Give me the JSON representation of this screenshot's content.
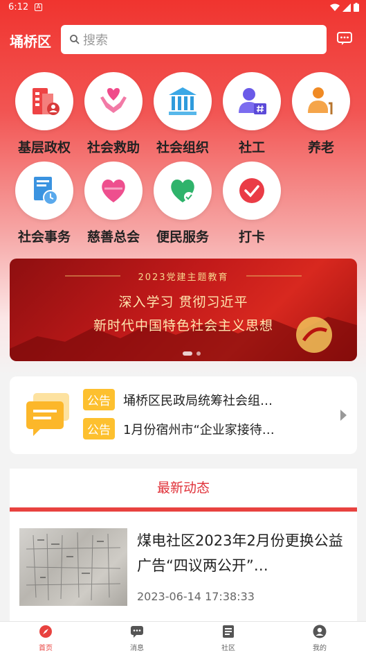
{
  "status": {
    "time": "6:12",
    "a_icon": "A"
  },
  "header": {
    "district": "埇桥区",
    "search_placeholder": "搜索"
  },
  "grid": [
    {
      "label": "基层政权",
      "icon": "building-person-icon"
    },
    {
      "label": "社会救助",
      "icon": "heart-hands-icon"
    },
    {
      "label": "社会组织",
      "icon": "institution-icon"
    },
    {
      "label": "社工",
      "icon": "person-id-icon"
    },
    {
      "label": "养老",
      "icon": "elder-cane-icon"
    },
    {
      "label": "社会事务",
      "icon": "document-clock-icon"
    },
    {
      "label": "慈善总会",
      "icon": "heart-ribbon-icon"
    },
    {
      "label": "便民服务",
      "icon": "heart-check-icon"
    },
    {
      "label": "打卡",
      "icon": "check-circle-icon"
    }
  ],
  "banner": {
    "subtitle": "2023党建主题教育",
    "line1": "深入学习 贯彻习近平",
    "line2": "新时代中国特色社会主义思想",
    "slide_active": 1,
    "slide_count": 2
  },
  "notices": {
    "tag": "公告",
    "items": [
      "埇桥区民政局统筹社会组…",
      "1月份宿州市“企业家接待…"
    ]
  },
  "news": {
    "header": "最新动态",
    "items": [
      {
        "title": "煤电社区2023年2月份更换公益广告“四议两公开”…",
        "time": "2023-06-14 17:38:33"
      }
    ]
  },
  "tabs": [
    {
      "label": "首页",
      "icon": "compass-icon",
      "active": true
    },
    {
      "label": "消息",
      "icon": "chat-icon",
      "active": false
    },
    {
      "label": "社区",
      "icon": "list-icon",
      "active": false
    },
    {
      "label": "我的",
      "icon": "user-icon",
      "active": false
    }
  ],
  "colors": {
    "accent": "#e8423f",
    "notice_tag": "#fdc02f"
  }
}
